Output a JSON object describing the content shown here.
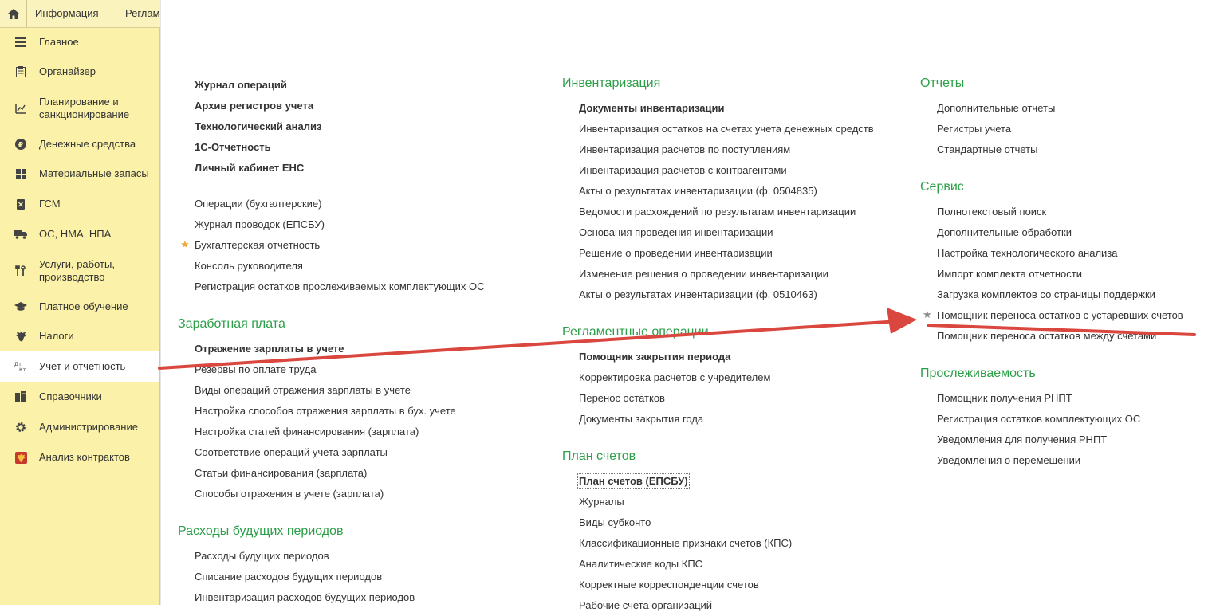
{
  "tabs": {
    "home_icon": "home-icon",
    "items": [
      "Информация",
      "Регламентированные отчеты"
    ]
  },
  "sidebar": {
    "items": [
      {
        "label": "Главное",
        "icon": "menu-lines-icon"
      },
      {
        "label": "Органайзер",
        "icon": "notepad-icon"
      },
      {
        "label": "Планирование и санкционирование",
        "icon": "planning-icon"
      },
      {
        "label": "Денежные средства",
        "icon": "coin-icon"
      },
      {
        "label": "Материальные запасы",
        "icon": "grid-icon"
      },
      {
        "label": "ГСМ",
        "icon": "fuel-icon"
      },
      {
        "label": "ОС, НМА, НПА",
        "icon": "truck-icon"
      },
      {
        "label": "Услуги, работы, производство",
        "icon": "tools-icon"
      },
      {
        "label": "Платное обучение",
        "icon": "graduation-cap-icon"
      },
      {
        "label": "Налоги",
        "icon": "eagle-emblem-icon"
      },
      {
        "label": "Учет и отчетность",
        "icon": "debit-credit-icon"
      },
      {
        "label": "Справочники",
        "icon": "books-icon"
      },
      {
        "label": "Администрирование",
        "icon": "gear-icon"
      },
      {
        "label": "Анализ контрактов",
        "icon": "coat-of-arms-icon"
      }
    ],
    "active_index": 10
  },
  "col1": {
    "top_bold": [
      "Журнал операций",
      "Архив регистров учета",
      "Технологический анализ",
      "1С-Отчетность",
      "Личный кабинет ЕНС"
    ],
    "top_links": [
      "Операции (бухгалтерские)",
      "Журнал проводок (ЕПСБУ)",
      "Бухгалтерская отчетность",
      "Консоль руководителя",
      "Регистрация остатков прослеживаемых комплектующих ОС"
    ],
    "zarplata": {
      "title": "Заработная плата",
      "items": [
        "Отражение зарплаты в учете",
        "Резервы по оплате труда",
        "Виды операций отражения зарплаты в учете",
        "Настройка способов отражения зарплаты в бух. учете",
        "Настройка статей финансирования (зарплата)",
        "Соответствие операций учета зарплаты",
        "Статьи финансирования (зарплата)",
        "Способы отражения в учете (зарплата)"
      ]
    },
    "rbp": {
      "title": "Расходы будущих периодов",
      "items": [
        "Расходы будущих периодов",
        "Списание расходов будущих периодов",
        "Инвентаризация расходов будущих периодов"
      ]
    }
  },
  "col2": {
    "inv": {
      "title": "Инвентаризация",
      "items": [
        "Документы инвентаризации",
        "Инвентаризация остатков на счетах учета денежных средств",
        "Инвентаризация расчетов по поступлениям",
        "Инвентаризация расчетов с контрагентами",
        "Акты о результатах инвентаризации (ф. 0504835)",
        "Ведомости расхождений по результатам инвентаризации",
        "Основания проведения инвентаризации",
        "Решение о проведении инвентаризации",
        "Изменение решения о проведении инвентаризации",
        "Акты о результатах инвентаризации (ф. 0510463)"
      ]
    },
    "reg": {
      "title": "Регламентные операции",
      "items": [
        "Помощник закрытия периода",
        "Корректировка расчетов с учредителем",
        "Перенос остатков",
        "Документы закрытия года"
      ]
    },
    "plan": {
      "title": "План счетов",
      "items": [
        "План счетов (ЕПСБУ)",
        "Журналы",
        "Виды субконто",
        "Классификационные признаки счетов (КПС)",
        "Аналитические коды КПС",
        "Корректные корреспонденции счетов",
        "Рабочие счета организаций"
      ]
    }
  },
  "col3": {
    "otchety": {
      "title": "Отчеты",
      "items": [
        "Дополнительные отчеты",
        "Регистры учета",
        "Стандартные отчеты"
      ]
    },
    "servis": {
      "title": "Сервис",
      "items": [
        "Полнотекстовый поиск",
        "Дополнительные обработки",
        "Настройка технологического анализа",
        "Импорт комплекта отчетности",
        "Загрузка комплектов со страницы поддержки",
        "Помощник переноса остатков с устаревших счетов",
        "Помощник переноса остатков между счетами"
      ]
    },
    "prosl": {
      "title": "Прослеживаемость",
      "items": [
        "Помощник получения РНПТ",
        "Регистрация остатков комплектующих ОС",
        "Уведомления для получения РНПТ",
        "Уведомления о перемещении"
      ]
    }
  },
  "colors": {
    "sidebar_bg": "#fbf1a8",
    "section_green": "#2c9f48",
    "star_favorite": "#f2a93b",
    "star_gray": "#8a8a8a",
    "annotation_red": "#d9473f"
  }
}
